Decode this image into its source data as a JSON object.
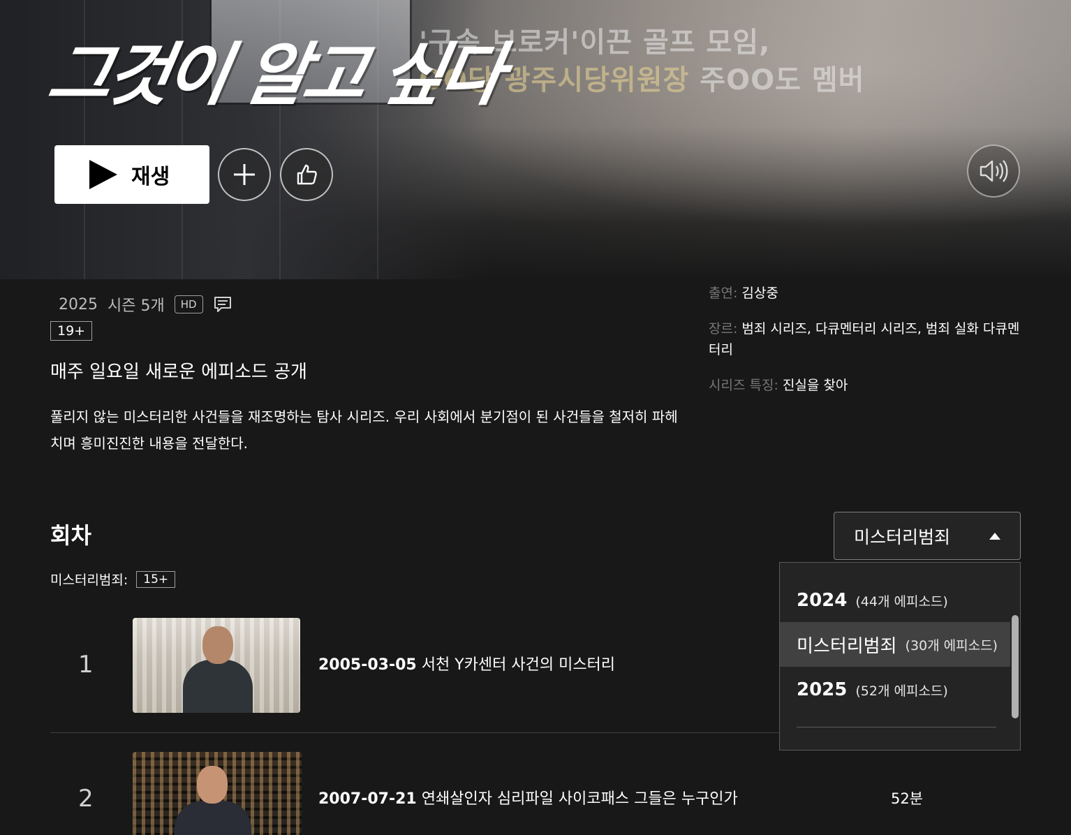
{
  "hero": {
    "show_title": "그것이 알고 싶다",
    "caption_line1": "'구속 브로커'이끈 골프 모임,",
    "caption_line2_highlight": "OO당 광주시당위원장",
    "caption_line2_rest": "주OO도 멤버",
    "play_label": "재생"
  },
  "icons": {
    "play": "play-icon",
    "add": "plus-icon",
    "like": "thumbs-up-icon",
    "volume": "volume-icon",
    "subtitles": "subtitles-icon",
    "dropdown": "caret-up-icon"
  },
  "meta": {
    "year": "2025",
    "seasons": "시즌 5개",
    "quality": "HD",
    "maturity": "19+",
    "tagline": "매주 일요일 새로운 에피소드 공개",
    "synopsis": "풀리지 않는 미스터리한 사건들을 재조명하는 탐사 시리즈. 우리 사회에서 분기점이 된 사건들을 철저히 파헤치며 흥미진진한 내용을 전달한다."
  },
  "side": {
    "cast_label": "출연:",
    "cast_value": "김상중",
    "genres_label": "장르:",
    "genres_value": "범죄 시리즈, 다큐멘터리 시리즈, 범죄 실화 다큐멘터리",
    "traits_label": "시리즈 특징:",
    "traits_value": "진실을 찾아"
  },
  "episodes": {
    "heading": "회차",
    "selected_season": "미스터리범죄",
    "season_label": "미스터리범죄:",
    "season_rating": "15+",
    "items": [
      {
        "number": "1",
        "date": "2005-03-05",
        "title": "서천 Y카센터 사건의 미스터리",
        "duration": ""
      },
      {
        "number": "2",
        "date": "2007-07-21",
        "title": "연쇄살인자 심리파일 사이코패스 그들은 누구인가",
        "duration": "52분"
      }
    ]
  },
  "season_menu": {
    "options": [
      {
        "name": "2024",
        "count": "(44개 에피소드)"
      },
      {
        "name": "미스터리범죄",
        "count": "(30개 에피소드)"
      },
      {
        "name": "2025",
        "count": "(52개 에피소드)"
      }
    ]
  }
}
